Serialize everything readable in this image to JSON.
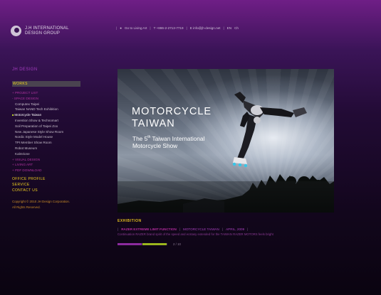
{
  "logo": {
    "line1": "J.H INTERNATIONAL",
    "line2": "DESIGN GROUP"
  },
  "topbar": {
    "items": [
      "Go to Living Art",
      "T +886-2-2713-7719",
      "E info@jh-design.net",
      "EN",
      "Ch"
    ],
    "separator": "|"
  },
  "sidebar": {
    "section_title": "JH DESIGN",
    "works_label": "WORKS",
    "nav": [
      {
        "label": "+ PROJECT LIST",
        "kind": "cat"
      },
      {
        "label": "- SPACE DESIGN",
        "kind": "cat"
      },
      {
        "label": "Computex Taipei",
        "kind": "sub"
      },
      {
        "label": "Taiwan NAND Tech Exhibition",
        "kind": "sub"
      },
      {
        "label": "Motorcycle Taiwan",
        "kind": "active"
      },
      {
        "label": "Invention Show & Technomart",
        "kind": "sub"
      },
      {
        "label": "Soil Preparation of Taipei Zoo",
        "kind": "sub"
      },
      {
        "label": "New Japanese Style Show Room",
        "kind": "sub"
      },
      {
        "label": "Nordic Style Model House",
        "kind": "sub"
      },
      {
        "label": "TPI Member Show Room",
        "kind": "sub"
      },
      {
        "label": "Robot Museum",
        "kind": "sub"
      },
      {
        "label": "Kalmrione",
        "kind": "sub"
      },
      {
        "label": "+ VISUAL DESIGN",
        "kind": "cat"
      },
      {
        "label": "+ LIVING ART",
        "kind": "cat"
      },
      {
        "label": "+ PDF DOWNLOAD",
        "kind": "cat"
      }
    ],
    "main_menu": [
      "OFFICE PROFILE",
      "SERVICE",
      "CONTACT US"
    ],
    "copyright_line1": "Copyright © 2010 JH Design Corporation.",
    "copyright_line2": "All Rights Reserved."
  },
  "hero": {
    "title_line1": "MOTORCYCLE",
    "title_line2": "TAIWAN",
    "sub_line1_pre": "The 5",
    "sub_line1_sup": "th",
    "sub_line1_post": " Taiwan International",
    "sub_line2": "Motorcycle Show"
  },
  "caption": {
    "section_label": "EXHIBITION",
    "highlight": "RAZER EXTREME LIMIT FUNCTION",
    "category": "MOTORCYCLE TAIWAN",
    "date": "APRIL, 2009",
    "description": "Continuation RAZER brand spirit of the speed and ecstasy extended for the TAIWAN RAZER MOTORS feels bright"
  },
  "slideshow": {
    "counter": "2 / 10",
    "progress": 0.5
  },
  "colors": {
    "accent_yellow": "#f1d11f",
    "accent_magenta": "#b0339f",
    "accent_green": "#9bb51e"
  }
}
